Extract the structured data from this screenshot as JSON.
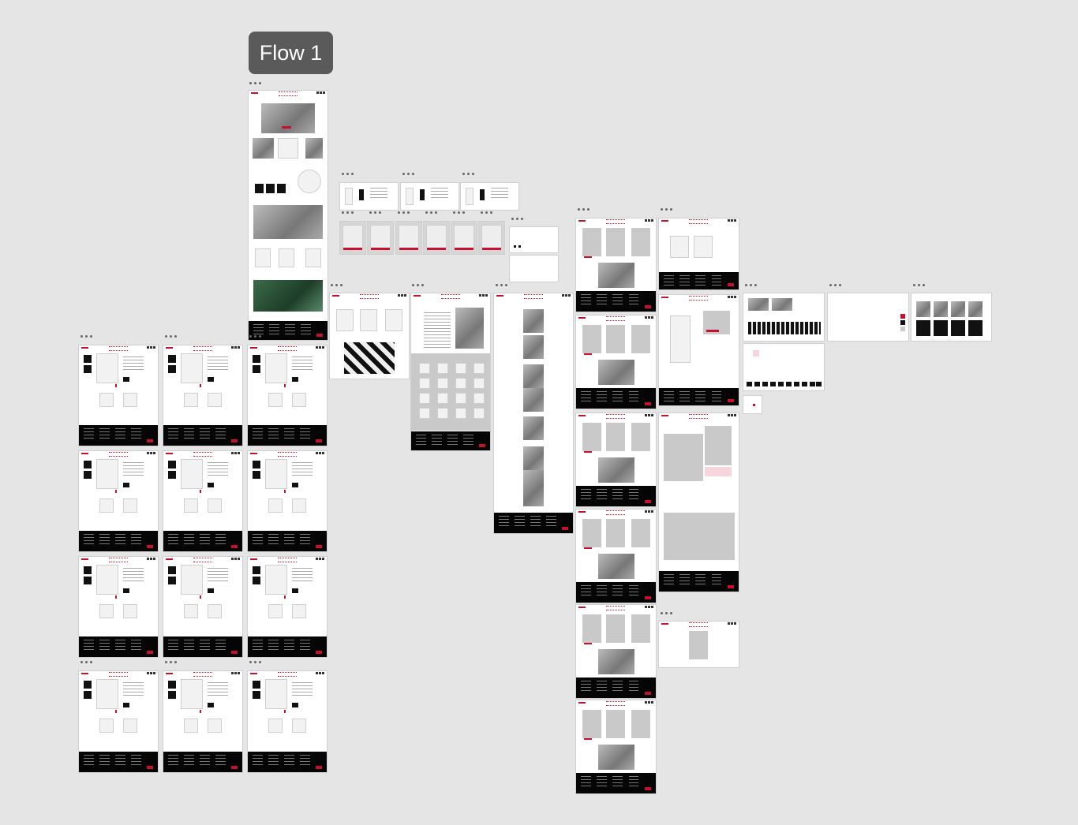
{
  "canvas": {
    "background": "#e5e5e5",
    "flow_label": "Flow 1"
  },
  "colors": {
    "accent": "#c8102e",
    "footer": "#050505",
    "badge": "#5a5a5a"
  },
  "frame_options_icon": "more-horizontal-icon"
}
